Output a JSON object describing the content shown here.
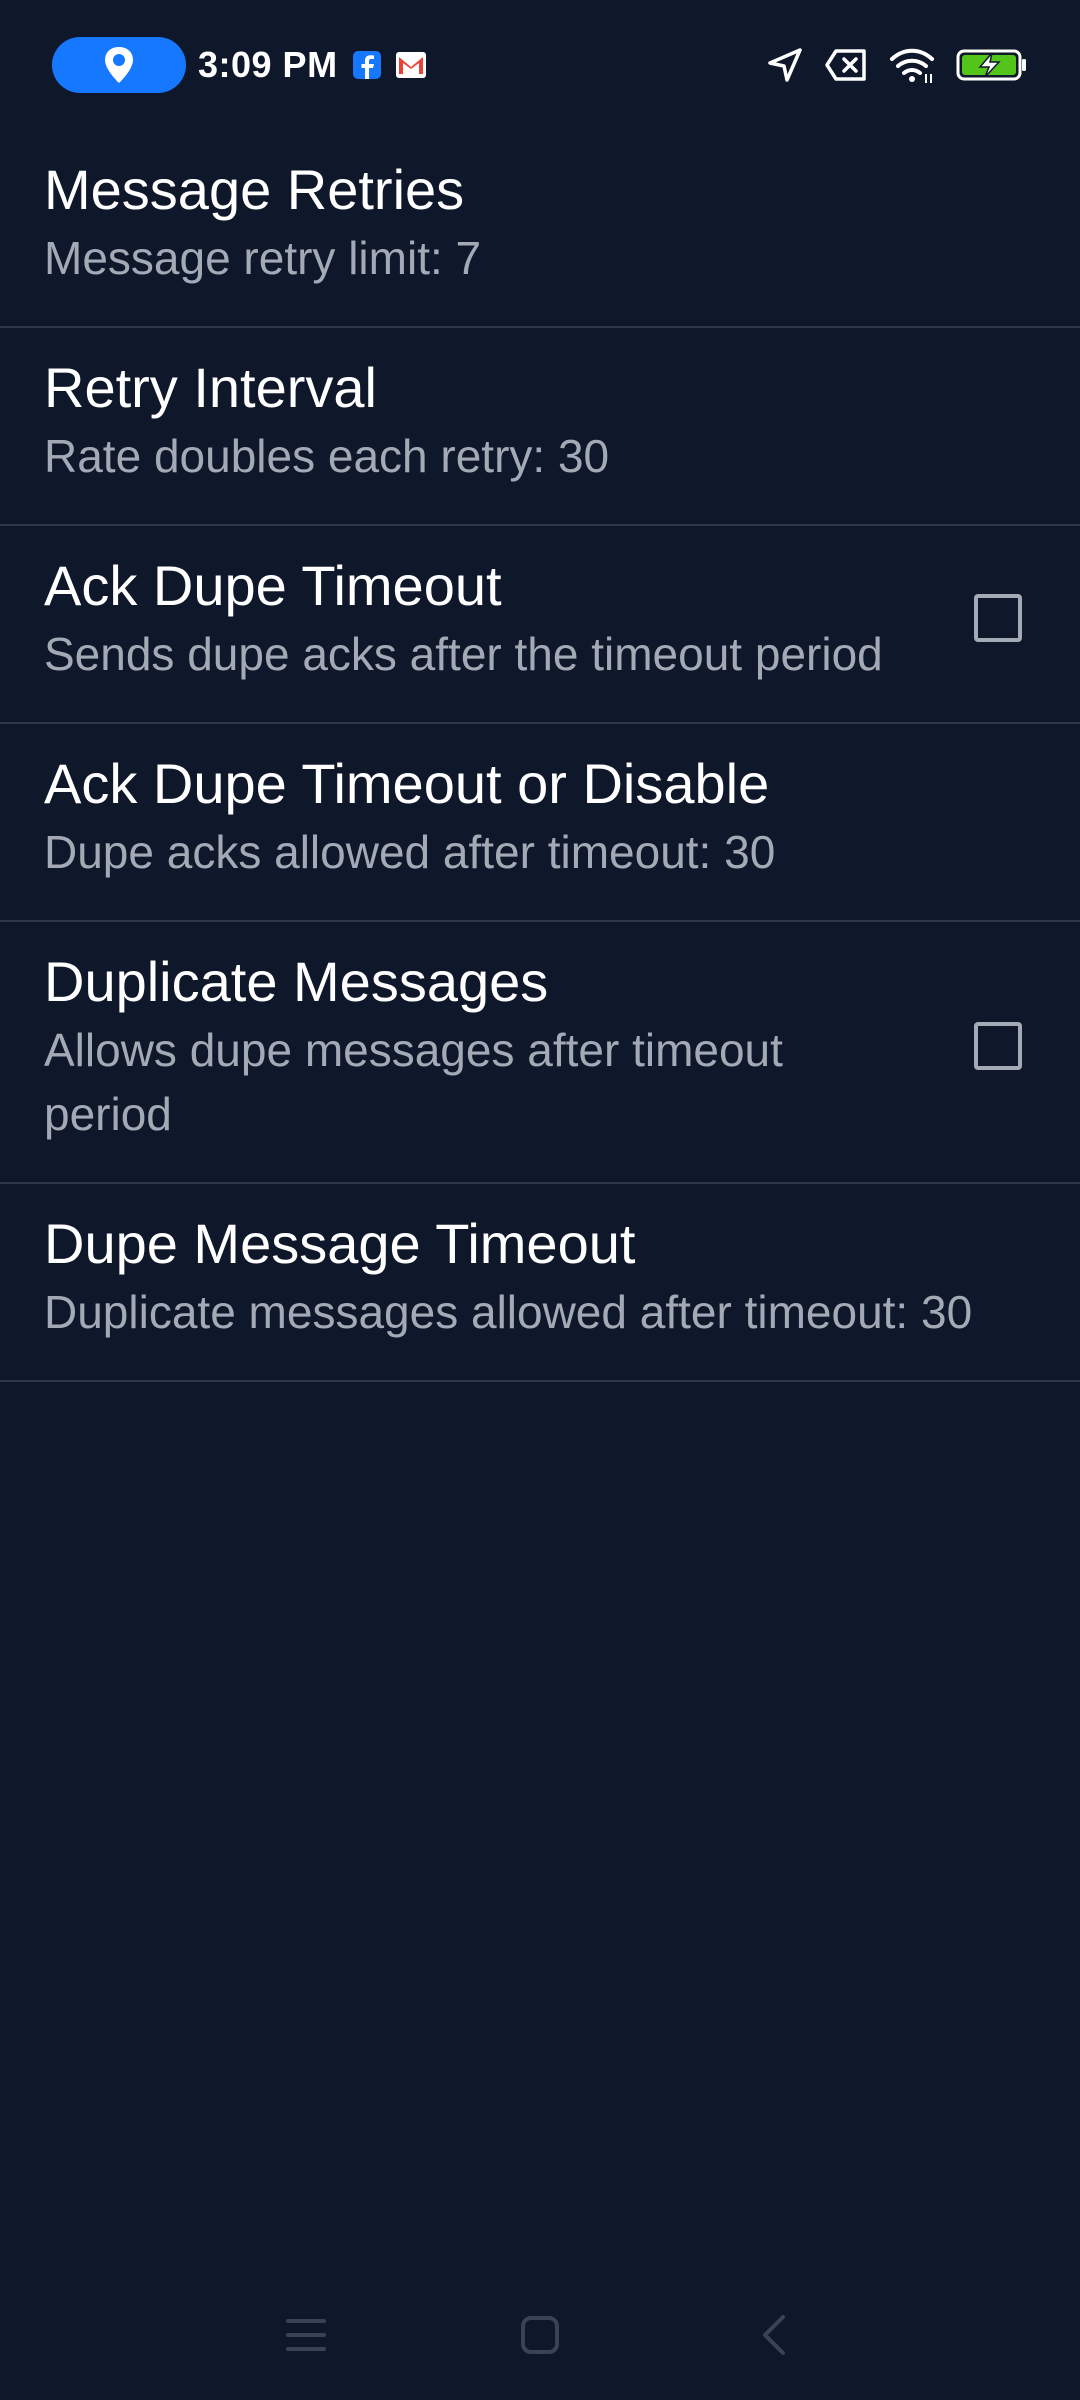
{
  "status_bar": {
    "time": "3:09 PM",
    "icons": [
      "location-pin-icon",
      "facebook-icon",
      "gmail-icon",
      "navigation-arrow-icon",
      "no-sim-icon",
      "wifi-icon",
      "battery-charging-icon"
    ],
    "accent": "#1677ff",
    "battery_color": "#52c41a"
  },
  "preferences": [
    {
      "title": "Message Retries",
      "summary": "Message retry limit: 7",
      "has_checkbox": false
    },
    {
      "title": "Retry Interval",
      "summary": "Rate doubles each retry: 30",
      "has_checkbox": false
    },
    {
      "title": "Ack Dupe Timeout",
      "summary": "Sends dupe acks after the timeout period",
      "has_checkbox": true,
      "checked": false
    },
    {
      "title": "Ack Dupe Timeout or Disable",
      "summary": "Dupe acks allowed after timeout: 30",
      "has_checkbox": false
    },
    {
      "title": "Duplicate Messages",
      "summary": "Allows dupe messages after timeout period",
      "has_checkbox": true,
      "checked": false
    },
    {
      "title": "Dupe Message Timeout",
      "summary": "Duplicate messages allowed after timeout: 30",
      "has_checkbox": false
    }
  ],
  "nav_bar": {
    "buttons": [
      "menu-icon",
      "home-icon",
      "back-icon"
    ]
  },
  "colors": {
    "background": "#0f172a",
    "divider": "#2e3646",
    "title": "#ffffff",
    "summary": "#a3aab6"
  }
}
